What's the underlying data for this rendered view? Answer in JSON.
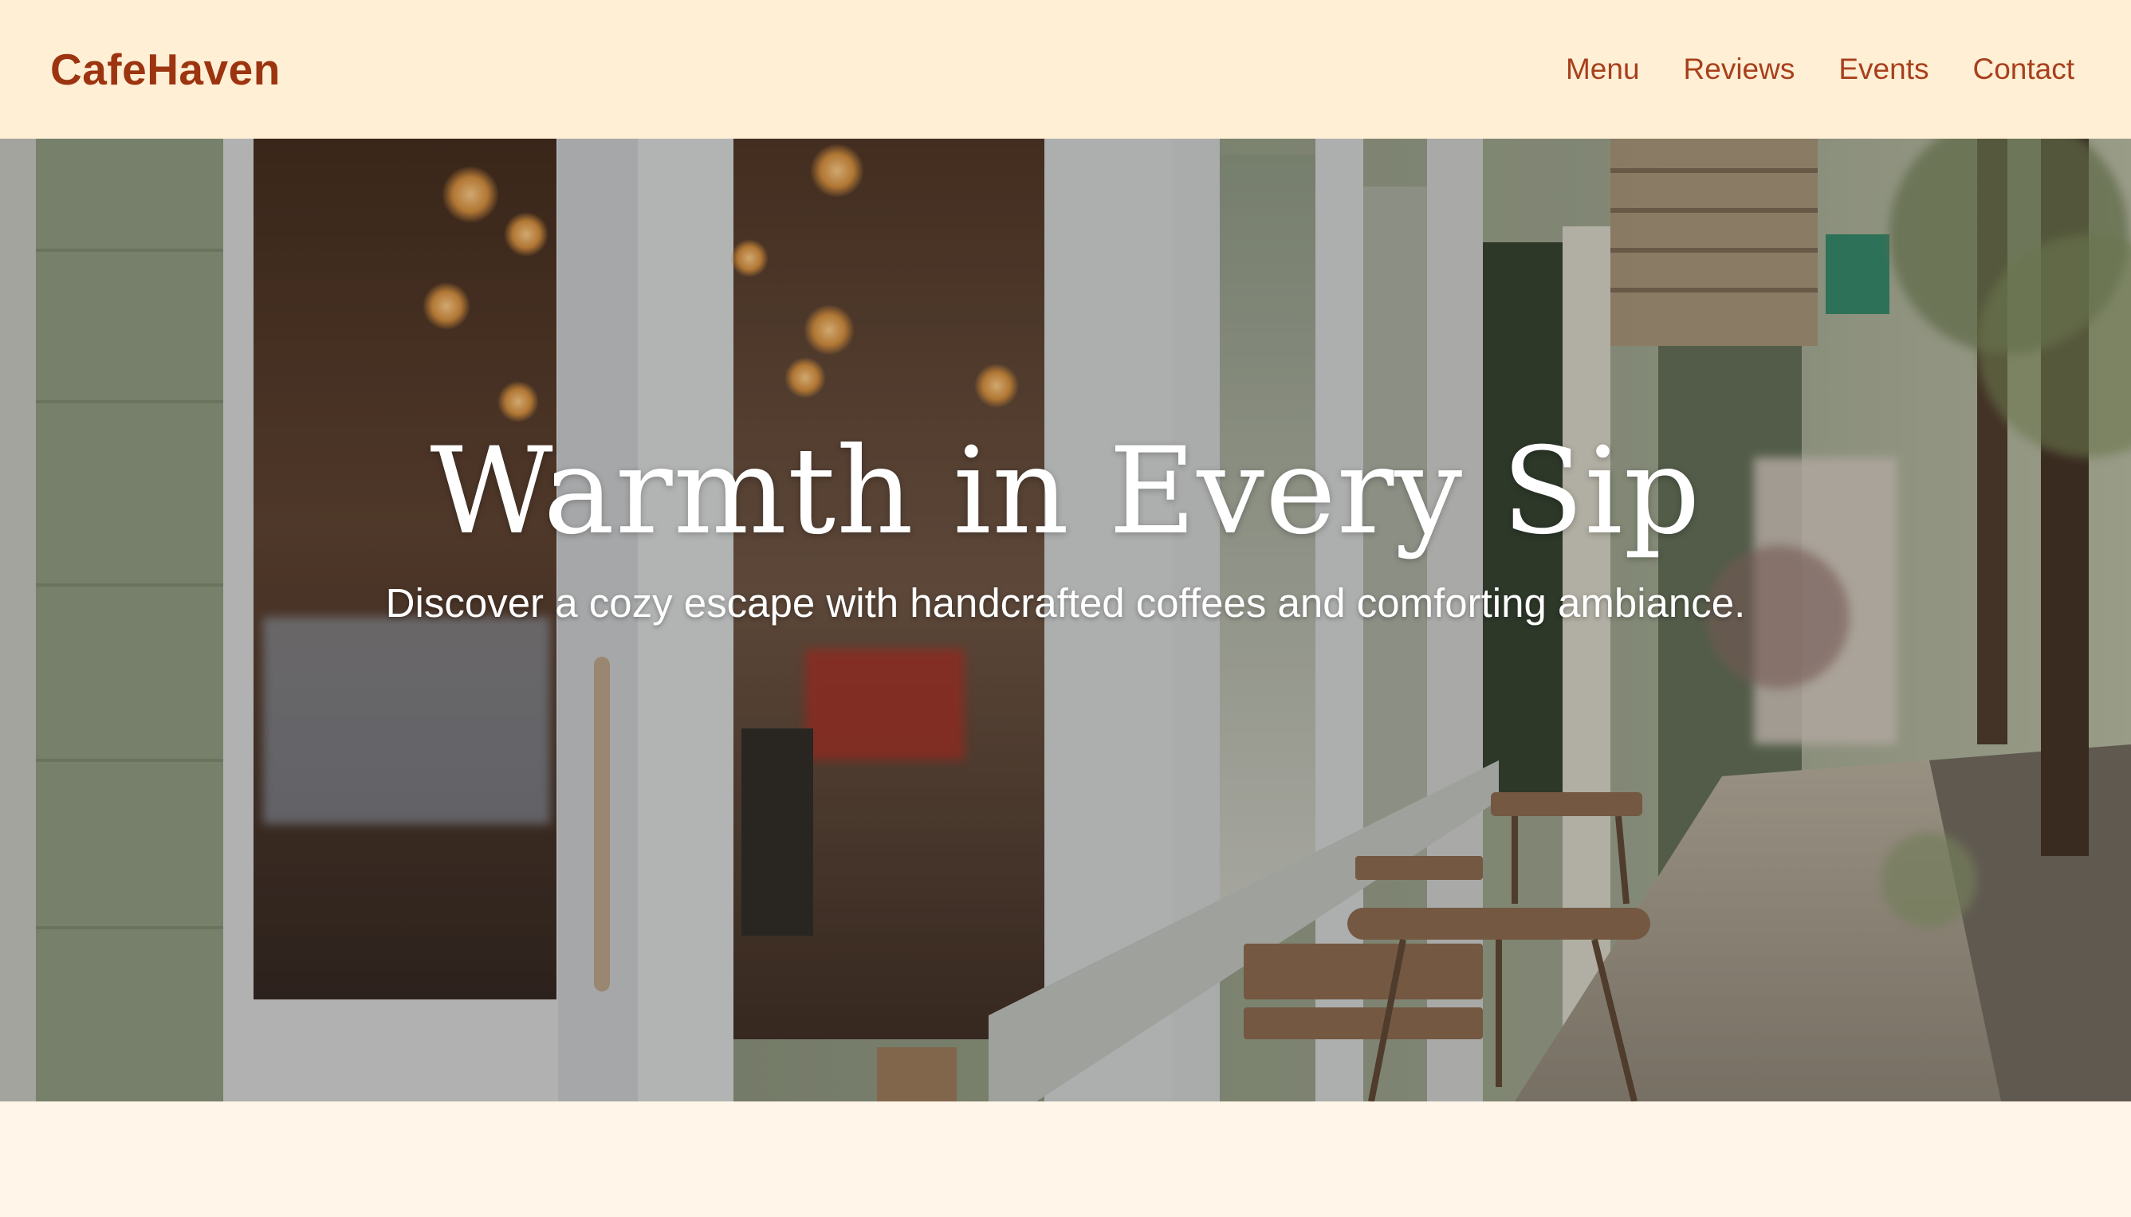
{
  "brand": {
    "name": "CafeHaven"
  },
  "nav": {
    "links": [
      {
        "label": "Menu"
      },
      {
        "label": "Reviews"
      },
      {
        "label": "Events"
      },
      {
        "label": "Contact"
      }
    ]
  },
  "hero": {
    "title": "Warmth in Every Sip",
    "subtitle": "Discover a cozy escape with handcrafted coffees and comforting ambiance.",
    "image_description": "cafe-storefront-photo"
  },
  "colors": {
    "header_bg": "#ffefd5",
    "brand": "#9c3410",
    "nav_link": "#a8401c",
    "page_bg": "#fff5e9",
    "hero_text": "#ffffff"
  }
}
